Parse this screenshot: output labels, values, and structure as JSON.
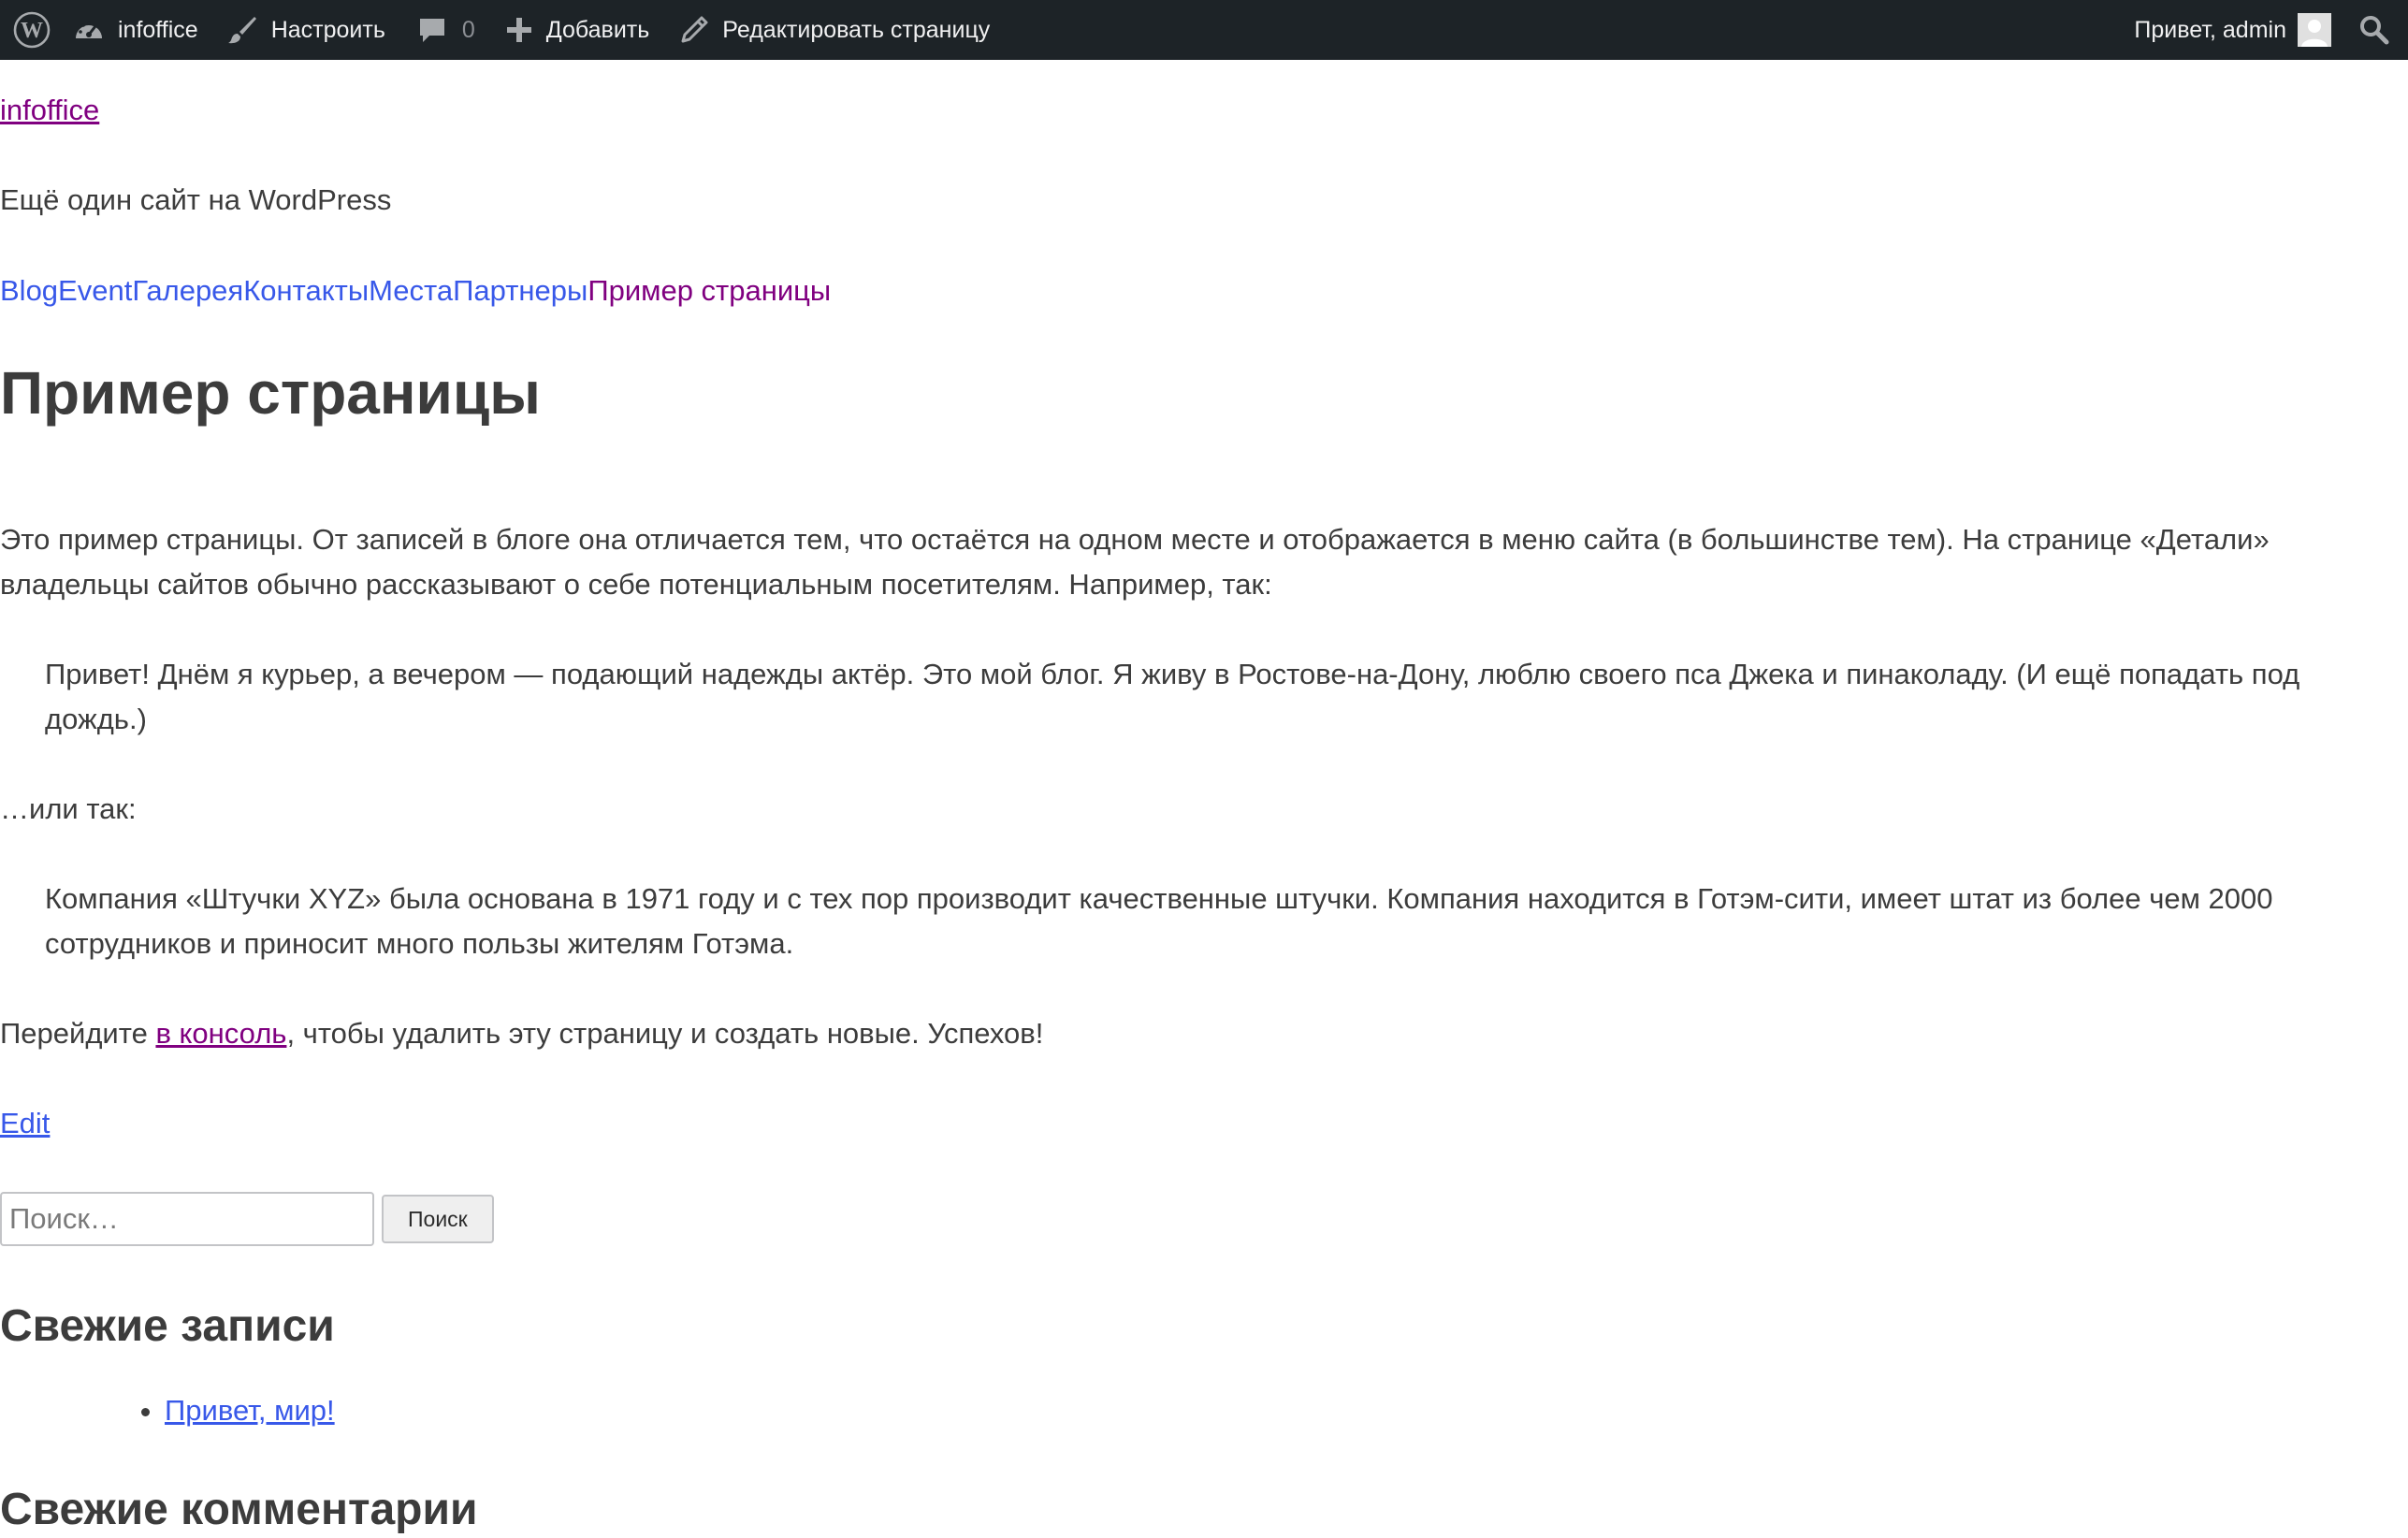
{
  "adminbar": {
    "site_name": "infoffice",
    "customize_label": "Настроить",
    "comments_count": "0",
    "add_label": "Добавить",
    "edit_page_label": "Редактировать страницу",
    "greeting": "Привет, admin"
  },
  "site": {
    "title": "infoffice",
    "description": "Ещё один сайт на WordPress"
  },
  "nav": {
    "items": [
      "Blog",
      "Event",
      "Галерея",
      "Контакты",
      "Места",
      "Партнеры",
      "Пример страницы"
    ],
    "current_index": 6
  },
  "page": {
    "title": "Пример страницы",
    "intro": "Это пример страницы. От записей в блоге она отличается тем, что остаётся на одном месте и отображается в меню сайта (в большинстве тем). На странице «Детали» владельцы сайтов обычно рассказывают о себе потенциальным посетителям. Например, так:",
    "quote1": "Привет! Днём я курьер, а вечером — подающий надежды актёр. Это мой блог. Я живу в Ростове-на-Дону, люблю своего пса Джека и пинаколаду. (И ещё попадать под дождь.)",
    "or_text": "…или так:",
    "quote2": "Компания «Штучки XYZ» была основана в 1971 году и с тех пор производит качественные штучки. Компания находится в Готэм-сити, имеет штат из более чем 2000 сотрудников и приносит много пользы жителям Готэма.",
    "outro_before": "Перейдите ",
    "outro_link": "в консоль",
    "outro_after": ", чтобы удалить эту страницу и создать новые. Успехов!",
    "edit_link": "Edit"
  },
  "search": {
    "placeholder": "Поиск…",
    "button_label": "Поиск"
  },
  "widgets": {
    "recent_posts_title": "Свежие записи",
    "recent_posts": [
      "Привет, мир!"
    ],
    "recent_comments_title": "Свежие комментарии"
  },
  "colors": {
    "adminbar_bg": "#1d2327",
    "visited_link": "#800080",
    "link": "#3858e9",
    "text": "#3c3c3c"
  },
  "icons": [
    "wordpress-logo-icon",
    "dashboard-icon",
    "brush-icon",
    "comment-icon",
    "plus-icon",
    "pencil-icon",
    "avatar",
    "search-icon"
  ]
}
